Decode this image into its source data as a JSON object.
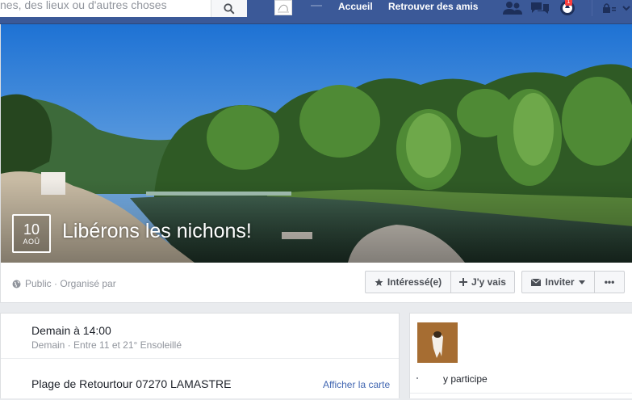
{
  "topbar": {
    "search_placeholder": "nes, des lieux ou d'autres choses",
    "nav_home": "Accueil",
    "nav_friends": "Retrouver des amis",
    "notification_count": "1",
    "icons": [
      "search-icon",
      "friend-requests-icon",
      "messages-icon",
      "notifications-icon",
      "privacy-lock-icon",
      "chevron-down-icon"
    ],
    "brand_color": "#3b5998"
  },
  "event": {
    "date_day": "10",
    "date_month": "AOÛ",
    "title": "Libérons les nichons!",
    "privacy": "Public · Organisé par",
    "buttons": {
      "interested": "Intéressé(e)",
      "going": "J'y vais",
      "invite": "Inviter",
      "more": "•••"
    }
  },
  "details": {
    "when_title": "Demain à 14:00",
    "when_sub": "Demain · Entre 11 et 21° Ensoleillé",
    "where_title": "Plage de Retourtour 07270 LAMASTRE",
    "map_link": "Afficher la carte"
  },
  "attendees": {
    "text": "y participe"
  }
}
